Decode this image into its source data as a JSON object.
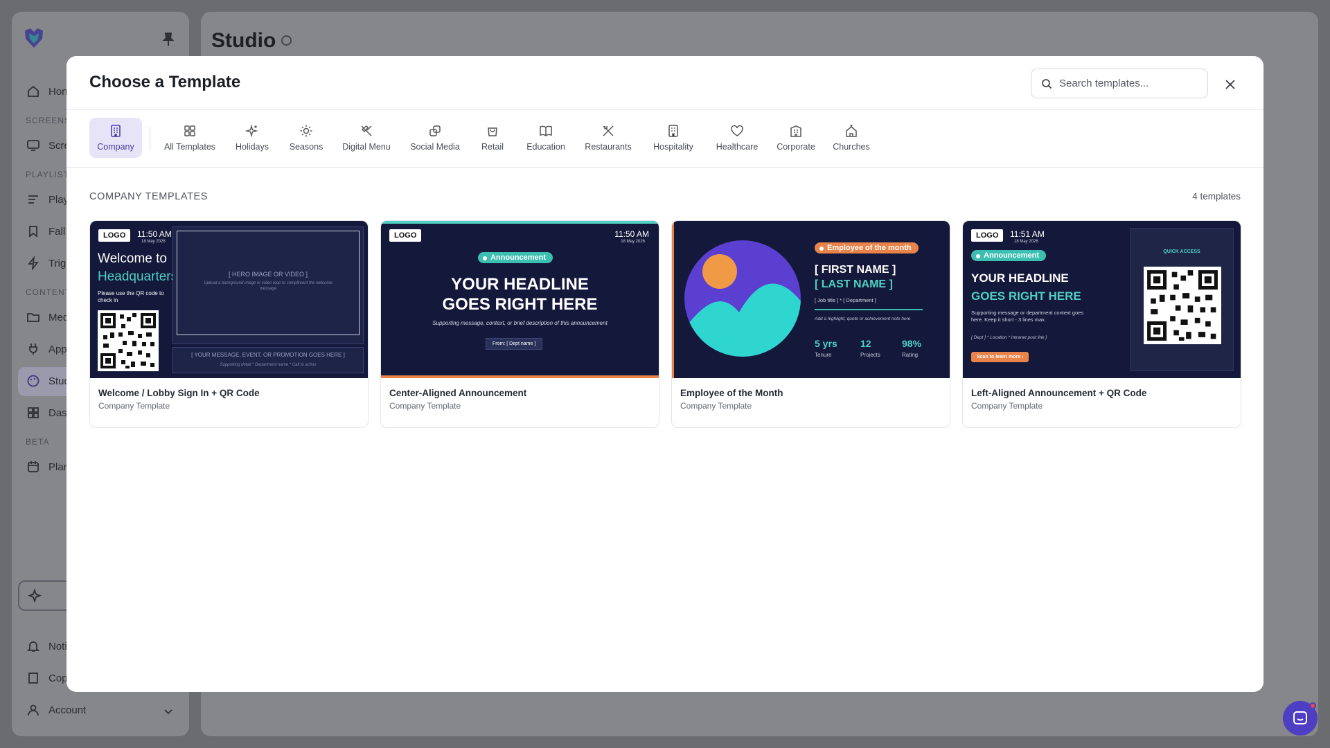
{
  "background": {
    "page_title": "Studio",
    "sidebar": {
      "items": [
        {
          "label": "Hon"
        },
        {
          "label": "Scre"
        },
        {
          "label": "Play"
        },
        {
          "label": "Fall"
        },
        {
          "label": "Trig"
        },
        {
          "label": "Med"
        },
        {
          "label": "App"
        },
        {
          "label": "Stud"
        },
        {
          "label": "Das"
        },
        {
          "label": "Plar"
        },
        {
          "label": "Noti"
        },
        {
          "label": "Cop"
        },
        {
          "label": "Account"
        }
      ],
      "sections": [
        "SCREENS",
        "PLAYLIST",
        "CONTENT",
        "BETA"
      ]
    }
  },
  "modal": {
    "title": "Choose a Template",
    "search": {
      "placeholder": "Search templates..."
    },
    "tabs": [
      {
        "label": "Company",
        "icon": "building-icon"
      },
      {
        "label": "All Templates",
        "icon": "grid-icon"
      },
      {
        "label": "Holidays",
        "icon": "sparkles-icon"
      },
      {
        "label": "Seasons",
        "icon": "sun-icon"
      },
      {
        "label": "Digital Menu",
        "icon": "utensils-icon"
      },
      {
        "label": "Social Media",
        "icon": "share-icon"
      },
      {
        "label": "Retail",
        "icon": "shopping-bag-icon"
      },
      {
        "label": "Education",
        "icon": "book-icon"
      },
      {
        "label": "Restaurants",
        "icon": "restaurant-icon"
      },
      {
        "label": "Hospitality",
        "icon": "hotel-icon"
      },
      {
        "label": "Healthcare",
        "icon": "heart-icon"
      },
      {
        "label": "Corporate",
        "icon": "office-icon"
      },
      {
        "label": "Churches",
        "icon": "church-icon"
      }
    ],
    "active_tab": "Company",
    "section_title": "COMPANY TEMPLATES",
    "count_label": "4 templates",
    "templates": [
      {
        "name": "Welcome / Lobby Sign In + QR Code",
        "category": "Company Template",
        "preview": {
          "logo": "LOGO",
          "time": "11:50 AM",
          "date": "18 May 2026",
          "line1": "Welcome to",
          "line2": "Headquarters",
          "instruction": "Please use the QR code to check in",
          "hero": "[ HERO IMAGE OR VIDEO ]",
          "hero_sub": "Upload a background image or video loop to compliment the welcome message",
          "message": "[ YOUR MESSAGE, EVENT, OR PROMOTION GOES HERE ]",
          "message_sub": "Supporting detail * Department name * Call to action"
        }
      },
      {
        "name": "Center-Aligned Announcement",
        "category": "Company Template",
        "preview": {
          "logo": "LOGO",
          "time": "11:50 AM",
          "date": "18 May 2026",
          "badge": "Announcement",
          "headline1": "YOUR HEADLINE",
          "headline2": "GOES RIGHT HERE",
          "support": "Supporting message, context, or brief description of this announcement",
          "from": "From: [ Dept name ]"
        }
      },
      {
        "name": "Employee of the Month",
        "category": "Company Template",
        "preview": {
          "badge": "Employee of the month",
          "first": "[ FIRST NAME ]",
          "last": "[ LAST NAME ]",
          "role": "[ Job title ] * [ Department ]",
          "note": "Add a highlight, quote or achievement note here",
          "stats": [
            {
              "value": "5 yrs",
              "label": "Tenure"
            },
            {
              "value": "12",
              "label": "Projects"
            },
            {
              "value": "98%",
              "label": "Rating"
            }
          ]
        }
      },
      {
        "name": "Left-Aligned Announcement + QR Code",
        "category": "Company Template",
        "preview": {
          "logo": "LOGO",
          "time": "11:51 AM",
          "date": "18 May 2026",
          "badge": "Announcement",
          "headline1": "YOUR HEADLINE",
          "headline2": "GOES RIGHT HERE",
          "support": "Supporting message or department context goes here. Keep it short - 3 lines max.",
          "meta": "[ Dept ] * Location * Intranet post link ]",
          "cta": "Scan to learn more ›",
          "quick_access": "QUICK ACCESS"
        }
      }
    ]
  },
  "colors": {
    "accent": "#4b3fa8",
    "active_tab_bg": "#e8e4f7",
    "thumb_bg": "#14183a",
    "teal": "#4fd1c5",
    "orange": "#e8844a",
    "chat": "#4e3fc2"
  }
}
